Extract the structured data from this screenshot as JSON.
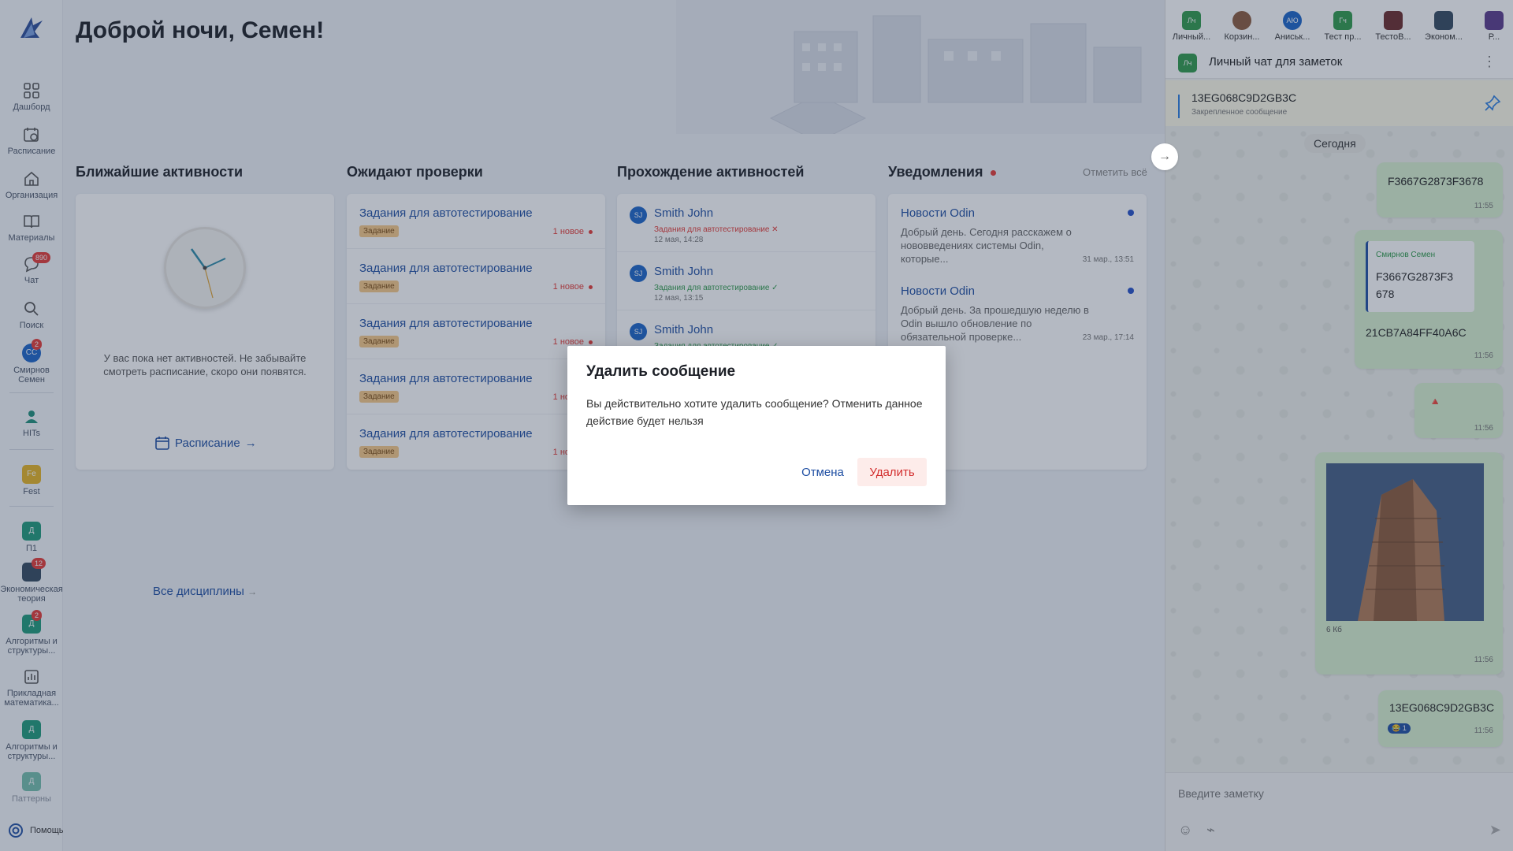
{
  "sidebar": {
    "items": [
      {
        "label": "Дашборд"
      },
      {
        "label": "Расписание"
      },
      {
        "label": "Организация"
      },
      {
        "label": "Материалы"
      },
      {
        "label": "Чат",
        "badge": "890"
      },
      {
        "label": "Поиск"
      },
      {
        "label": "Смирнов Семен",
        "initials": "СС",
        "badge": "2"
      },
      {
        "label": "HITs"
      },
      {
        "label": "Fest",
        "initials": "Fe"
      },
      {
        "label": "П1",
        "initials": "Д"
      },
      {
        "label": "Экономическая теория",
        "badge": "12"
      },
      {
        "label": "Алгоритмы и структуры...",
        "initials": "Д",
        "badge": "2"
      },
      {
        "label": "Прикладная математика..."
      },
      {
        "label": "Алгоритмы и структуры...",
        "initials": "Д"
      },
      {
        "label": "Паттерны",
        "initials": "Д"
      }
    ],
    "help": "Помощь"
  },
  "main": {
    "greeting": "Доброй ночи, Семен!",
    "upcoming": {
      "title": "Ближайшие активности",
      "empty": "У вас пока нет активностей. Не забывайте смотреть расписание, скоро они появятся.",
      "link": "Расписание"
    },
    "review": {
      "title": "Ожидают проверки",
      "tasks": [
        {
          "title": "Задания для автотестирование",
          "tag": "Задание",
          "new": "1 новое"
        },
        {
          "title": "Задания для автотестирование",
          "tag": "Задание",
          "new": "1 новое"
        },
        {
          "title": "Задания для автотестирование",
          "tag": "Задание",
          "new": "1 новое"
        },
        {
          "title": "Задания для автотестирование",
          "tag": "Задание",
          "new": "1 новое"
        },
        {
          "title": "Задания для автотестирование",
          "tag": "Задание",
          "new": "1 новое"
        }
      ]
    },
    "progress": {
      "title": "Прохождение активностей",
      "items": [
        {
          "initials": "SJ",
          "name": "Smith John",
          "status": "Задания для автотестирование ✕",
          "date": "12 мая, 14:28",
          "color": "#e53935"
        },
        {
          "initials": "SJ",
          "name": "Smith John",
          "status": "Задания для автотестирование ✓",
          "date": "12 мая, 13:15",
          "color": "#2e9a4a"
        },
        {
          "initials": "SJ",
          "name": "Smith John",
          "status": "Задания для автотестирование ✓",
          "date": "",
          "color": "#2e9a4a"
        }
      ]
    },
    "notifications": {
      "title": "Уведомления",
      "mark_all": "Отметить всё",
      "items": [
        {
          "title": "Новости Odin",
          "body": "Добрый день. Сегодня расскажем о нововведениях системы Odin, которые...",
          "date": "31 мар., 13:51"
        },
        {
          "title": "Новости Odin",
          "body": "Добрый день.  За прошедшую неделю в Odin вышло обновление по обязательной проверке...",
          "date": "23 мар., 17:14"
        }
      ]
    },
    "all_disciplines": "Все дисциплины"
  },
  "chat": {
    "tabs": [
      {
        "initials": "Лч",
        "name": "Личный...",
        "color": "#2e9a4a"
      },
      {
        "initials": "",
        "name": "Корзин...",
        "color": "#8a5a3c"
      },
      {
        "initials": "АЮ",
        "name": "Аниськ...",
        "color": "#1b64c8"
      },
      {
        "initials": "Гч",
        "name": "Тест пр...",
        "color": "#2e9a4a"
      },
      {
        "initials": "",
        "name": "ТестоВ...",
        "color": "#6b2a2a"
      },
      {
        "initials": "",
        "name": "Эконом...",
        "color": "#34495e"
      },
      {
        "initials": "",
        "name": "Р...",
        "color": "#5a3a8a"
      }
    ],
    "header_initials": "Лч",
    "header_title": "Личный чат для заметок",
    "pinned": {
      "text": "13EG068C9D2GB3C",
      "label": "Закрепленное сообщение"
    },
    "date_chip": "Сегодня",
    "messages": [
      {
        "text": "F3667G2873F3678",
        "time": "11:55"
      },
      {
        "quote_author": "Смирнов Семен",
        "quote_text": "F3667G2873F3 678",
        "text": "21CB7A84FF40A6C",
        "time": "11:56"
      },
      {
        "text": "🔺",
        "time": "11:56"
      },
      {
        "caption": "6 Кб",
        "time": "11:56"
      },
      {
        "text": "13EG068C9D2GB3C",
        "reaction": "😂 1",
        "time": "11:56"
      }
    ],
    "input_placeholder": "Введите заметку"
  },
  "dialog": {
    "title": "Удалить сообщение",
    "text": "Вы действительно хотите удалить сообщение? Отменить данное действие будет нельзя",
    "cancel": "Отмена",
    "delete": "Удалить"
  }
}
